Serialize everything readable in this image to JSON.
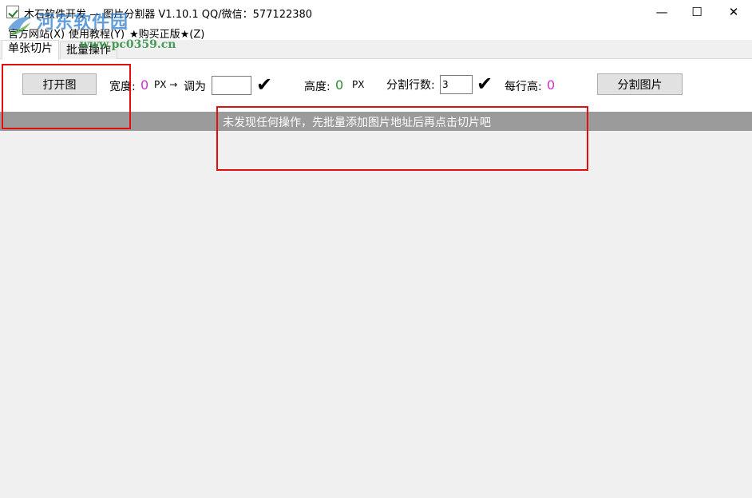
{
  "window": {
    "title": "木石软件开发 — 图片分割器 V1.10.1   QQ/微信：577122380",
    "minimize_glyph": "—",
    "maximize_glyph": "☐",
    "close_glyph": "✕"
  },
  "menu": {
    "items": [
      {
        "label": "官方网站(X)"
      },
      {
        "label": "使用教程(Y)"
      },
      {
        "label": "★购买正版★(Z)"
      }
    ]
  },
  "watermark": {
    "title": "河东软件园",
    "url": "www.pc0359.cn"
  },
  "tabs": [
    {
      "label": "单张切片"
    },
    {
      "label": "批量操作"
    }
  ],
  "toolbar": {
    "open_button": "打开图",
    "width_label": "宽度:",
    "width_value": "0",
    "width_unit": "PX →",
    "resize_label": "调为",
    "resize_input_value": "",
    "height_label": "高度:",
    "height_value": "0",
    "height_unit": "PX",
    "rows_label": "分割行数:",
    "rows_input_value": "3",
    "row_height_label": "每行高:",
    "row_height_value": "0",
    "split_button": "分割图片",
    "check_glyph": "✔"
  },
  "status": {
    "message": "未发现任何操作，先批量添加图片地址后再点击切片吧"
  },
  "colors": {
    "width_value": "#cc33cc",
    "height_value": "#2e8b2e",
    "row_height_value": "#cc33cc",
    "status_bar": "#9b9b9b",
    "annotation_box": "#e01010"
  }
}
